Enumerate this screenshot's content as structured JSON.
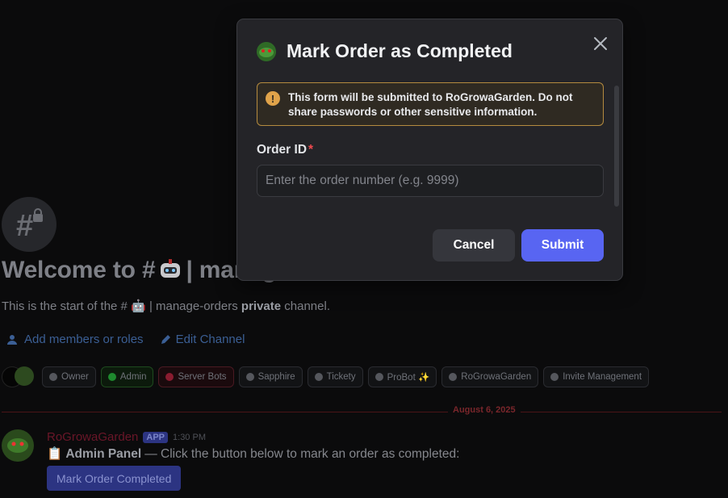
{
  "background": {
    "welcome_prefix": "Welcome to #",
    "welcome_suffix": "| manage-orders!",
    "start_prefix": "This is the start of the #",
    "start_channel": "| manage-orders",
    "start_private": "private",
    "start_suffix": "channel.",
    "add_members_label": "Add members or roles",
    "edit_channel_label": "Edit Channel",
    "roles": [
      {
        "label": "Owner",
        "style": "normal"
      },
      {
        "label": "Admin",
        "style": "admin"
      },
      {
        "label": "Server Bots",
        "style": "bots"
      },
      {
        "label": "Sapphire",
        "style": "normal"
      },
      {
        "label": "Tickety",
        "style": "normal"
      },
      {
        "label": "ProBot ✨",
        "style": "normal"
      },
      {
        "label": "RoGrowaGarden",
        "style": "normal"
      },
      {
        "label": "Invite Management",
        "style": "normal"
      }
    ],
    "date_divider": "August 6, 2025",
    "message": {
      "author": "RoGrowaGarden",
      "badge": "APP",
      "time": "1:30 PM",
      "emoji": "📋",
      "bold": "Admin Panel",
      "text": "— Click the button below to mark an order as completed:",
      "button_label": "Mark Order Completed"
    }
  },
  "modal": {
    "title": "Mark Order as Completed",
    "warning_bold": "This form will be submitted to RoGrowaGarden.",
    "warning_text": "Do not share passwords or other sensitive information.",
    "field_label": "Order ID",
    "required_mark": "*",
    "input_value": "",
    "input_placeholder": "Enter the order number (e.g. 9999)",
    "cancel_label": "Cancel",
    "submit_label": "Submit"
  },
  "colors": {
    "accent": "#5865f2",
    "warning_border": "#b58b3f",
    "required": "#f04a4f"
  }
}
